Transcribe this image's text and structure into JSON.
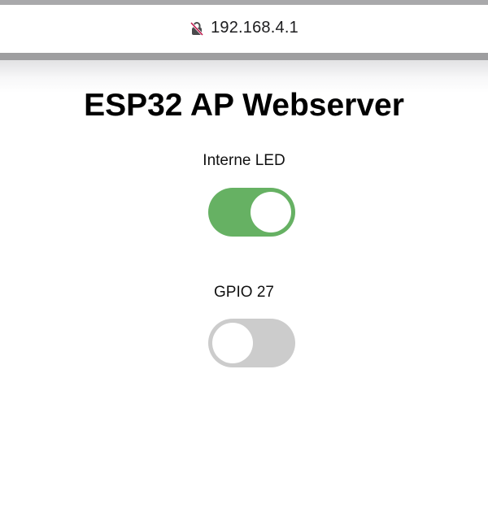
{
  "browser": {
    "url": "192.168.4.1",
    "security_icon": "not-secure-lock-icon"
  },
  "page": {
    "title": "ESP32 AP Webserver"
  },
  "controls": [
    {
      "label": "Interne LED",
      "on": true
    },
    {
      "label": "GPIO 27",
      "on": false
    }
  ],
  "colors": {
    "toggle_on": "#66b163",
    "toggle_off": "#cccccc",
    "knob": "#ffffff",
    "title": "#000000"
  }
}
